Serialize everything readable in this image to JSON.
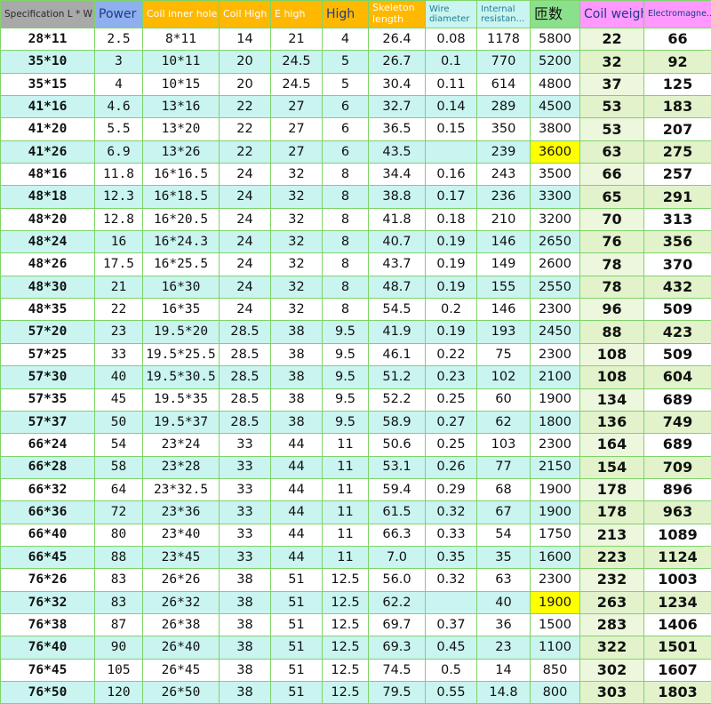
{
  "table": {
    "headers": [
      "Specification L * W",
      "Power",
      "Coil inner hole",
      "Coil High",
      "E high",
      "High",
      "Skeleton length",
      "Wire diameter",
      "Internal resistan...",
      "匝数",
      "Coil weigh",
      "Electromagne..."
    ],
    "header_colors": {
      "spec": "#a9a9a9",
      "power": "#8fb0ee",
      "orange": "#ffb800",
      "wire": "#c9f4ef",
      "turns": "#8be08b",
      "coil_weight": "#ff99ff"
    },
    "row_colors": {
      "odd": "#ffffff",
      "even": "#c9f4ef",
      "highlight": "#ffff00",
      "border": "#7fd36a"
    },
    "rows": [
      [
        "28*11",
        "2.5",
        "8*11",
        "14",
        "21",
        "4",
        "26.4",
        "0.08",
        "1178",
        "5800",
        "22",
        "66"
      ],
      [
        "35*10",
        "3",
        "10*11",
        "20",
        "24.5",
        "5",
        "26.7",
        "0.1",
        "770",
        "5200",
        "32",
        "92"
      ],
      [
        "35*15",
        "4",
        "10*15",
        "20",
        "24.5",
        "5",
        "30.4",
        "0.11",
        "614",
        "4800",
        "37",
        "125"
      ],
      [
        "41*16",
        "4.6",
        "13*16",
        "22",
        "27",
        "6",
        "32.7",
        "0.14",
        "289",
        "4500",
        "53",
        "183"
      ],
      [
        "41*20",
        "5.5",
        "13*20",
        "22",
        "27",
        "6",
        "36.5",
        "0.15",
        "350",
        "3800",
        "53",
        "207"
      ],
      [
        "41*26",
        "6.9",
        "13*26",
        "22",
        "27",
        "6",
        "43.5",
        "",
        "239",
        "3600",
        "63",
        "275"
      ],
      [
        "48*16",
        "11.8",
        "16*16.5",
        "24",
        "32",
        "8",
        "34.4",
        "0.16",
        "243",
        "3500",
        "66",
        "257"
      ],
      [
        "48*18",
        "12.3",
        "16*18.5",
        "24",
        "32",
        "8",
        "38.8",
        "0.17",
        "236",
        "3300",
        "65",
        "291"
      ],
      [
        "48*20",
        "12.8",
        "16*20.5",
        "24",
        "32",
        "8",
        "41.8",
        "0.18",
        "210",
        "3200",
        "70",
        "313"
      ],
      [
        "48*24",
        "16",
        "16*24.3",
        "24",
        "32",
        "8",
        "40.7",
        "0.19",
        "146",
        "2650",
        "76",
        "356"
      ],
      [
        "48*26",
        "17.5",
        "16*25.5",
        "24",
        "32",
        "8",
        "43.7",
        "0.19",
        "149",
        "2600",
        "78",
        "370"
      ],
      [
        "48*30",
        "21",
        "16*30",
        "24",
        "32",
        "8",
        "48.7",
        "0.19",
        "155",
        "2550",
        "78",
        "432"
      ],
      [
        "48*35",
        "22",
        "16*35",
        "24",
        "32",
        "8",
        "54.5",
        "0.2",
        "146",
        "2300",
        "96",
        "509"
      ],
      [
        "57*20",
        "23",
        "19.5*20",
        "28.5",
        "38",
        "9.5",
        "41.9",
        "0.19",
        "193",
        "2450",
        "88",
        "423"
      ],
      [
        "57*25",
        "33",
        "19.5*25.5",
        "28.5",
        "38",
        "9.5",
        "46.1",
        "0.22",
        "75",
        "2300",
        "108",
        "509"
      ],
      [
        "57*30",
        "40",
        "19.5*30.5",
        "28.5",
        "38",
        "9.5",
        "51.2",
        "0.23",
        "102",
        "2100",
        "108",
        "604"
      ],
      [
        "57*35",
        "45",
        "19.5*35",
        "28.5",
        "38",
        "9.5",
        "52.2",
        "0.25",
        "60",
        "1900",
        "134",
        "689"
      ],
      [
        "57*37",
        "50",
        "19.5*37",
        "28.5",
        "38",
        "9.5",
        "58.9",
        "0.27",
        "62",
        "1800",
        "136",
        "749"
      ],
      [
        "66*24",
        "54",
        "23*24",
        "33",
        "44",
        "11",
        "50.6",
        "0.25",
        "103",
        "2300",
        "164",
        "689"
      ],
      [
        "66*28",
        "58",
        "23*28",
        "33",
        "44",
        "11",
        "53.1",
        "0.26",
        "77",
        "2150",
        "154",
        "709"
      ],
      [
        "66*32",
        "64",
        "23*32.5",
        "33",
        "44",
        "11",
        "59.4",
        "0.29",
        "68",
        "1900",
        "178",
        "896"
      ],
      [
        "66*36",
        "72",
        "23*36",
        "33",
        "44",
        "11",
        "61.5",
        "0.32",
        "67",
        "1900",
        "178",
        "963"
      ],
      [
        "66*40",
        "80",
        "23*40",
        "33",
        "44",
        "11",
        "66.3",
        "0.33",
        "54",
        "1750",
        "213",
        "1089"
      ],
      [
        "66*45",
        "88",
        "23*45",
        "33",
        "44",
        "11",
        "7.0",
        "0.35",
        "35",
        "1600",
        "223",
        "1124"
      ],
      [
        "76*26",
        "83",
        "26*26",
        "38",
        "51",
        "12.5",
        "56.0",
        "0.32",
        "63",
        "2300",
        "232",
        "1003"
      ],
      [
        "76*32",
        "83",
        "26*32",
        "38",
        "51",
        "12.5",
        "62.2",
        "",
        "40",
        "1900",
        "263",
        "1234"
      ],
      [
        "76*38",
        "87",
        "26*38",
        "38",
        "51",
        "12.5",
        "69.7",
        "0.37",
        "36",
        "1500",
        "283",
        "1406"
      ],
      [
        "76*40",
        "90",
        "26*40",
        "38",
        "51",
        "12.5",
        "69.3",
        "0.45",
        "23",
        "1100",
        "322",
        "1501"
      ],
      [
        "76*45",
        "105",
        "26*45",
        "38",
        "51",
        "12.5",
        "74.5",
        "0.5",
        "14",
        "850",
        "302",
        "1607"
      ],
      [
        "76*50",
        "120",
        "26*50",
        "38",
        "51",
        "12.5",
        "79.5",
        "0.55",
        "14.8",
        "800",
        "303",
        "1803"
      ]
    ],
    "highlighted_cells": [
      [
        5,
        9
      ],
      [
        25,
        9
      ]
    ]
  }
}
